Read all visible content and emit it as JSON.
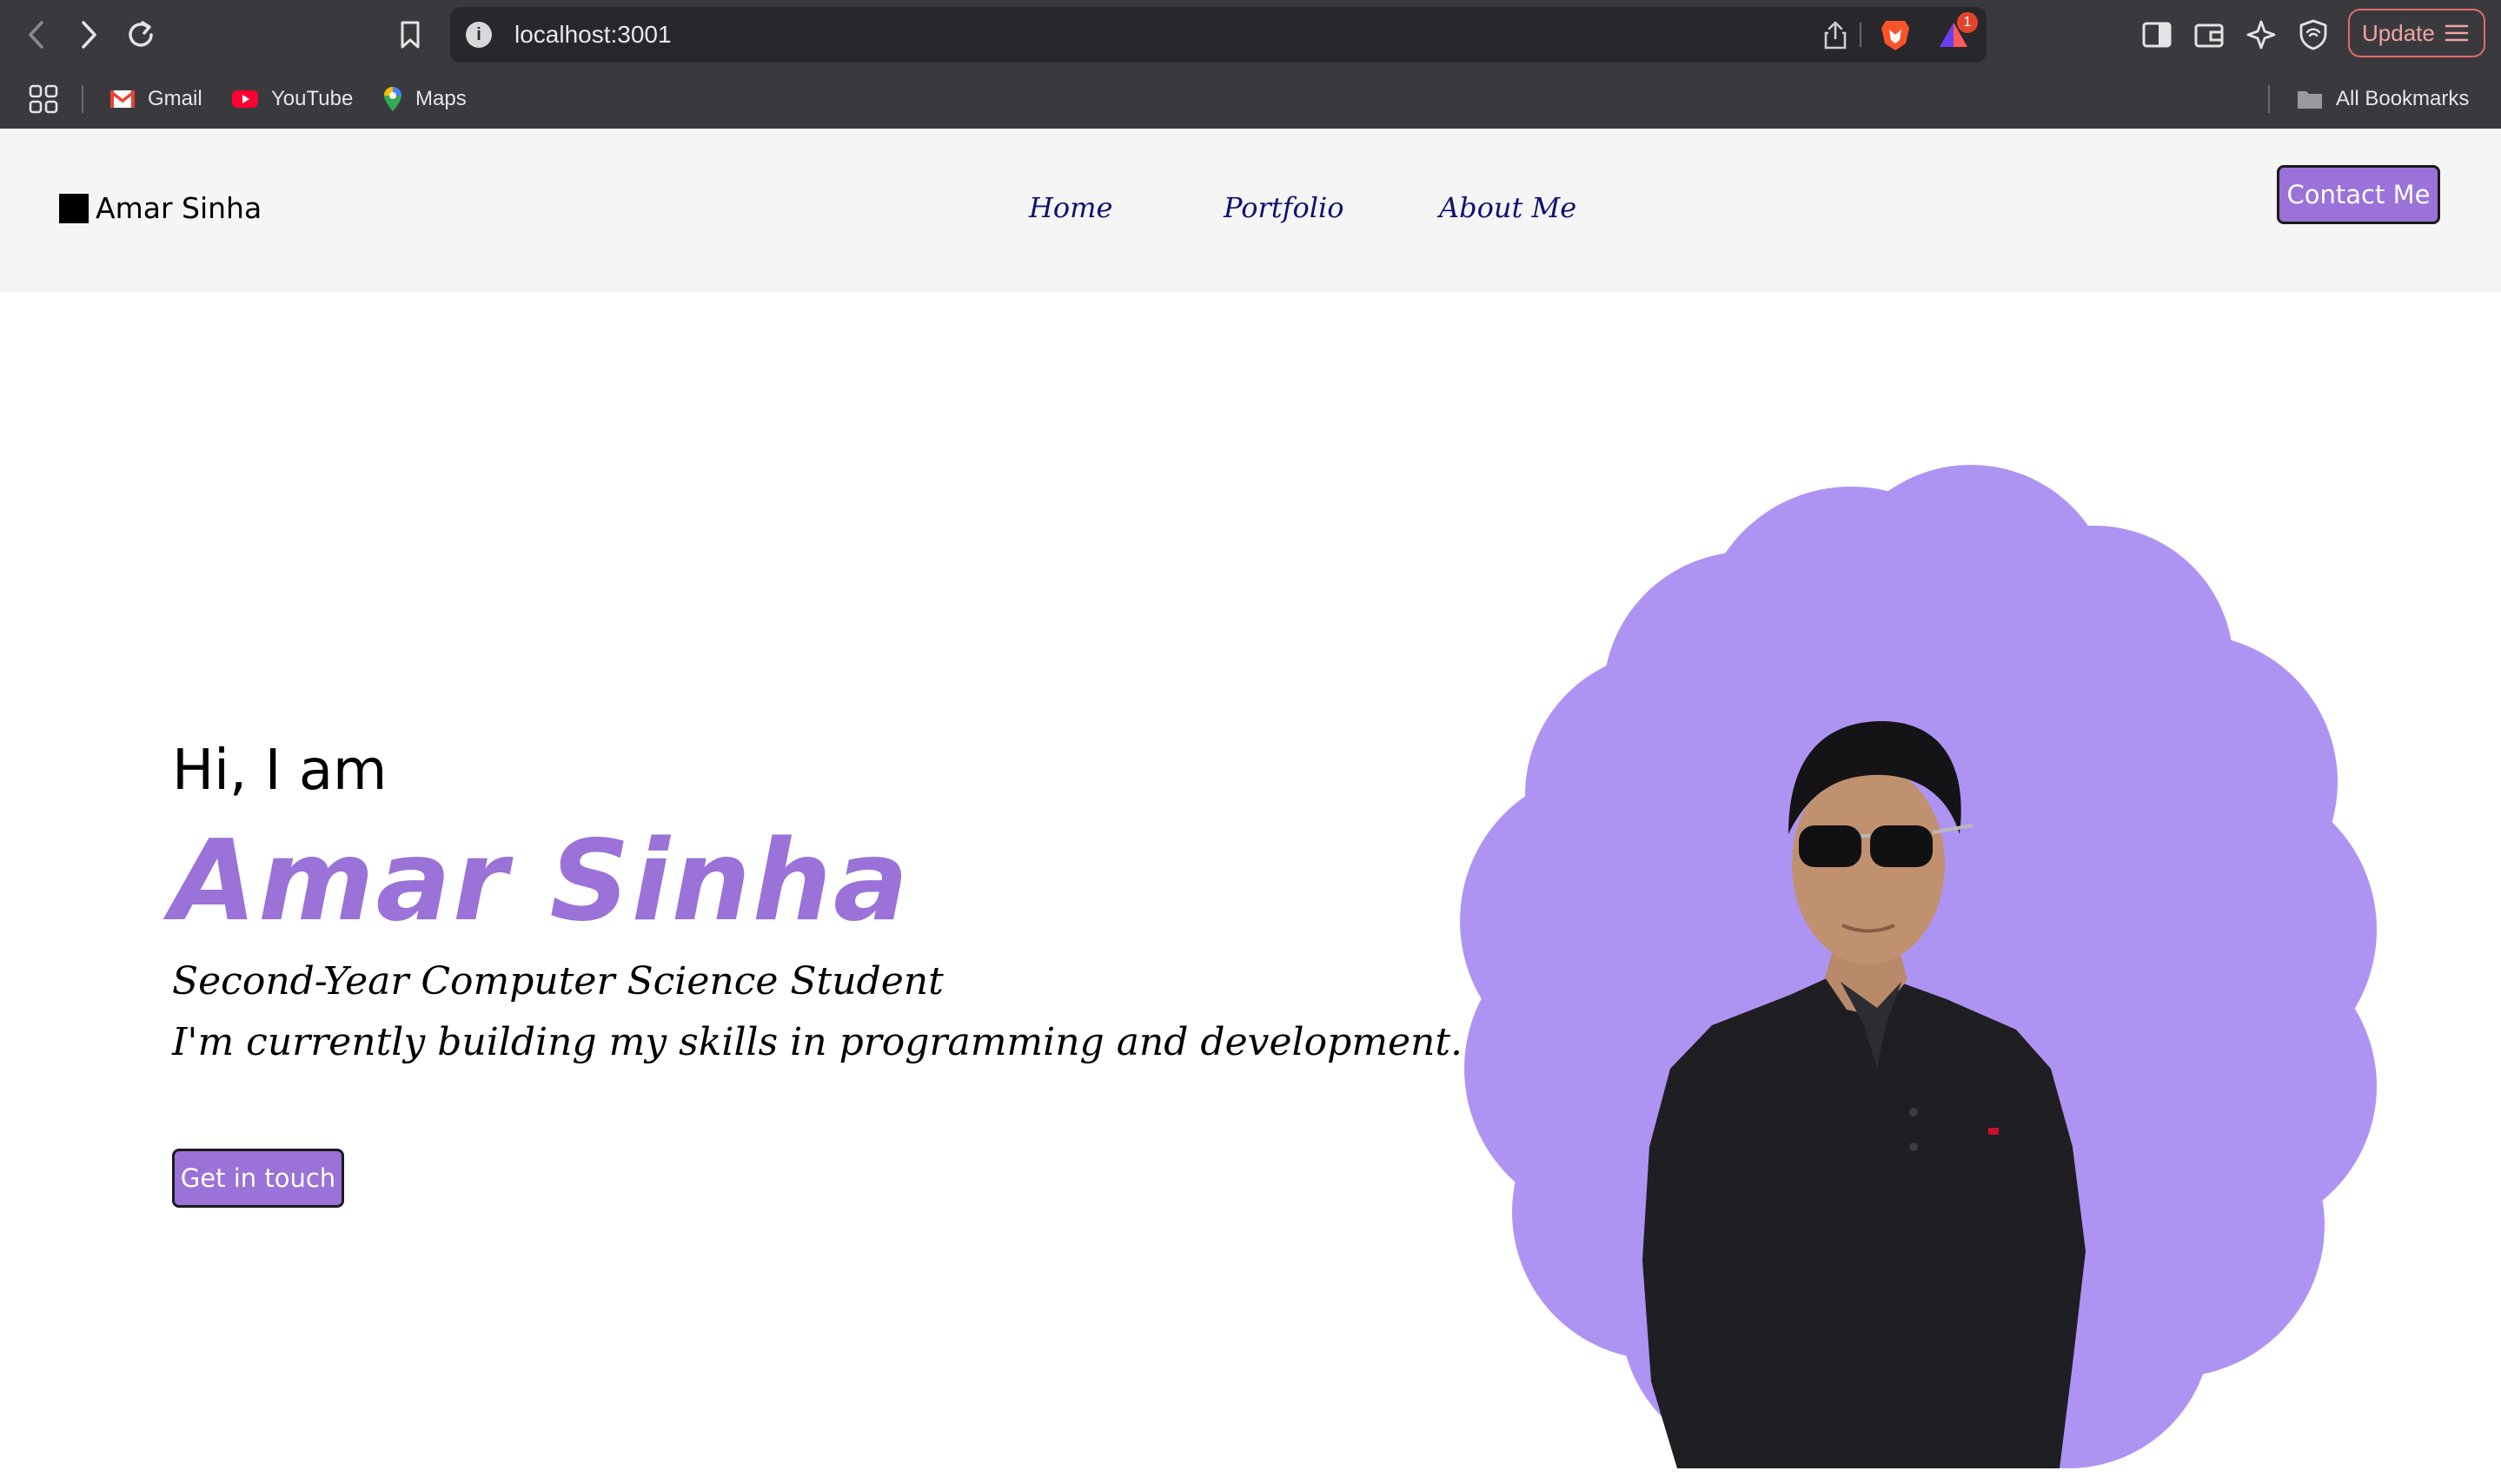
{
  "browser": {
    "url": "localhost:3001",
    "update_label": "Update",
    "shields_badge": "1",
    "bookmarks": [
      {
        "label": "Gmail"
      },
      {
        "label": "YouTube"
      },
      {
        "label": "Maps"
      }
    ],
    "all_bookmarks_label": "All Bookmarks",
    "icons": [
      "back-icon",
      "forward-icon",
      "reload-icon",
      "bookmark-icon",
      "site-info-icon",
      "share-icon",
      "brave-shields-icon",
      "rewards-icon",
      "sidebar-icon",
      "wallet-icon",
      "leo-icon",
      "vpn-icon",
      "menu-icon",
      "apps-icon",
      "folder-icon"
    ]
  },
  "header": {
    "brand": "Amar Sinha",
    "nav": [
      {
        "label": "Home"
      },
      {
        "label": "Portfolio"
      },
      {
        "label": "About Me"
      }
    ],
    "contact_label": "Contact Me"
  },
  "hero": {
    "greeting": "Hi, I am",
    "name": "Amar Sinha",
    "subtitle": "Second-Year Computer Science Student",
    "tagline": "I'm currently building my skills in programming and development.",
    "cta_label": "Get in touch"
  },
  "colors": {
    "accent": "#9a72d8",
    "blob": "#ae94f2",
    "nav_text": "#111170",
    "header_bg": "#f5f5f5",
    "chrome_bg": "#3a3a3e"
  }
}
